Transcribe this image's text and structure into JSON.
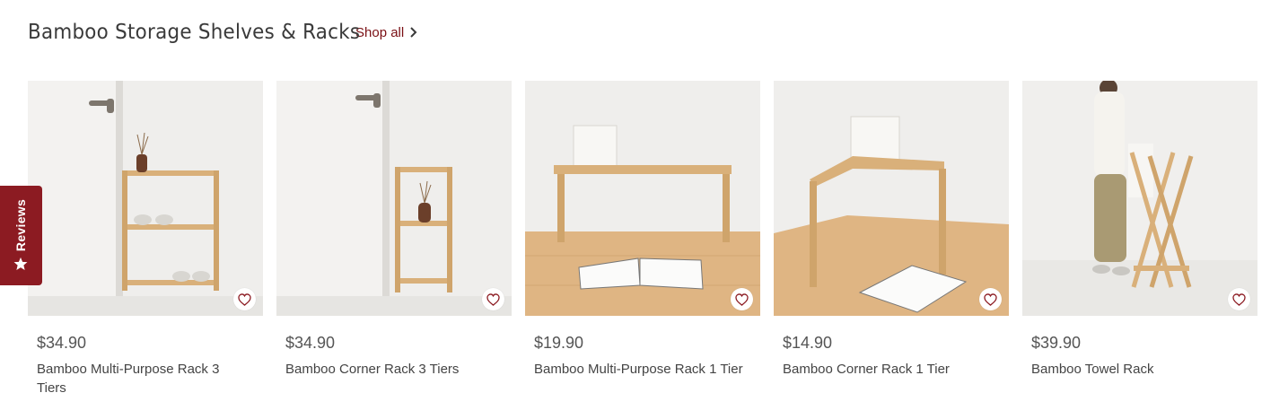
{
  "section": {
    "title": "Bamboo Storage Shelves & Racks",
    "shop_all_label": "Shop all"
  },
  "products": [
    {
      "price": "$34.90",
      "name": "Bamboo Multi-Purpose Rack 3 Tiers",
      "image_icon": "shelf-photo"
    },
    {
      "price": "$34.90",
      "name": "Bamboo Corner Rack 3 Tiers",
      "image_icon": "corner-shelf-photo"
    },
    {
      "price": "$19.90",
      "name": "Bamboo Multi-Purpose Rack 1 Tier",
      "image_icon": "bench-photo"
    },
    {
      "price": "$14.90",
      "name": "Bamboo Corner Rack 1 Tier",
      "image_icon": "corner-bench-photo"
    },
    {
      "price": "$39.90",
      "name": "Bamboo Towel Rack",
      "image_icon": "towel-rack-photo"
    }
  ],
  "reviews_tab": {
    "label": "Reviews",
    "icon": "star-icon"
  },
  "colors": {
    "accent": "#8c1b22",
    "link": "#7a0f14",
    "bamboo": "#dcb57e",
    "floor": "#d9ae7c"
  }
}
